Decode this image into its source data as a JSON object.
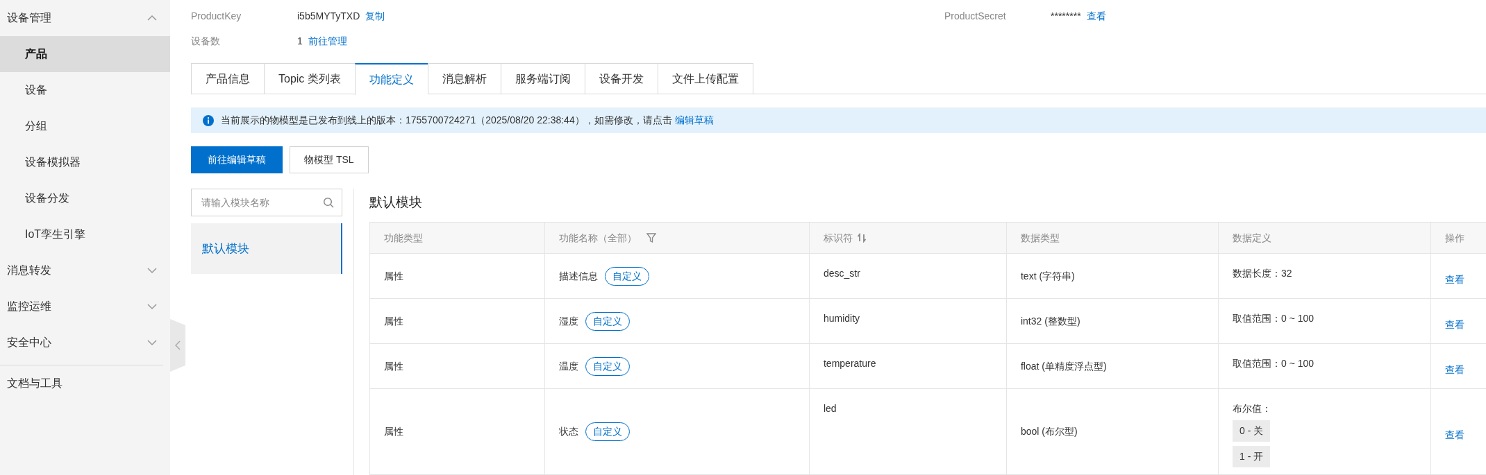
{
  "sidebar": {
    "groups": [
      {
        "label": "设备管理",
        "expanded": true,
        "children": [
          {
            "label": "产品",
            "selected": true
          },
          {
            "label": "设备",
            "selected": false
          },
          {
            "label": "分组",
            "selected": false
          },
          {
            "label": "设备模拟器",
            "selected": false
          },
          {
            "label": "设备分发",
            "selected": false
          },
          {
            "label": "IoT孪生引擎",
            "selected": false
          }
        ]
      },
      {
        "label": "消息转发",
        "expanded": false
      },
      {
        "label": "监控运维",
        "expanded": false
      },
      {
        "label": "安全中心",
        "expanded": false
      }
    ],
    "footer_item": "文档与工具"
  },
  "info": {
    "product_key": {
      "label": "ProductKey",
      "value": "i5b5MYTyTXD",
      "action": "复制"
    },
    "device_count": {
      "label": "设备数",
      "value": "1",
      "action": "前往管理"
    },
    "product_secret": {
      "label": "ProductSecret",
      "value": "********",
      "action": "查看"
    }
  },
  "tabs": [
    {
      "label": "产品信息",
      "selected": false
    },
    {
      "label": "Topic 类列表",
      "selected": false
    },
    {
      "label": "功能定义",
      "selected": true
    },
    {
      "label": "消息解析",
      "selected": false
    },
    {
      "label": "服务端订阅",
      "selected": false
    },
    {
      "label": "设备开发",
      "selected": false
    },
    {
      "label": "文件上传配置",
      "selected": false
    }
  ],
  "notice": {
    "text": "当前展示的物模型是已发布到线上的版本：1755700724271（2025/08/20 22:38:44），如需修改，请点击",
    "link": "编辑草稿"
  },
  "buttons": [
    {
      "label": "前往编辑草稿",
      "kind": "primary"
    },
    {
      "label": "物模型 TSL",
      "kind": "default"
    }
  ],
  "module_search": {
    "placeholder": "请输入模块名称"
  },
  "modules": [
    {
      "label": "默认模块",
      "selected": true
    }
  ],
  "module_title": "默认模块",
  "table": {
    "columns": [
      {
        "label": "功能类型",
        "kind": "plain"
      },
      {
        "label": "功能名称（全部）",
        "kind": "filter"
      },
      {
        "label": "标识符",
        "kind": "sort"
      },
      {
        "label": "数据类型",
        "kind": "plain"
      },
      {
        "label": "数据定义",
        "kind": "plain"
      },
      {
        "label": "操作",
        "kind": "plain"
      }
    ],
    "rows": [
      {
        "type": "属性",
        "name": "描述信息",
        "tag": "自定义",
        "identifier": "desc_str",
        "data_type": "text (字符串)",
        "definition": {
          "kind": "text",
          "text": "数据长度：32"
        },
        "action": "查看"
      },
      {
        "type": "属性",
        "name": "湿度",
        "tag": "自定义",
        "identifier": "humidity",
        "data_type": "int32 (整数型)",
        "definition": {
          "kind": "text",
          "text": "取值范围：0 ~ 100"
        },
        "action": "查看"
      },
      {
        "type": "属性",
        "name": "温度",
        "tag": "自定义",
        "identifier": "temperature",
        "data_type": "float (单精度浮点型)",
        "definition": {
          "kind": "text",
          "text": "取值范围：0 ~ 100"
        },
        "action": "查看"
      },
      {
        "type": "属性",
        "name": "状态",
        "tag": "自定义",
        "identifier": "led",
        "data_type": "bool (布尔型)",
        "definition": {
          "kind": "enum",
          "text": "布尔值：",
          "values": [
            "0 - 关",
            "1 - 开"
          ]
        },
        "action": "查看"
      }
    ]
  }
}
